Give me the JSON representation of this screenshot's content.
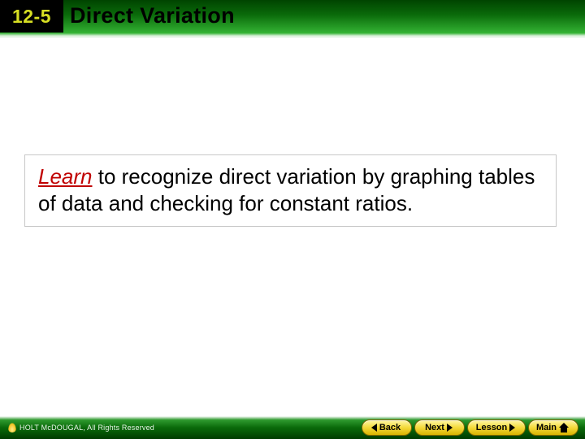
{
  "header": {
    "section_number": "12-5",
    "title": "Direct Variation"
  },
  "content": {
    "learn_label": "Learn",
    "objective_rest": " to recognize direct variation by graphing tables of data and checking for constant ratios."
  },
  "footer": {
    "copyright": "HOLT McDOUGAL, All Rights Reserved",
    "buttons": {
      "back": "Back",
      "next": "Next",
      "lesson": "Lesson",
      "main": "Main"
    }
  }
}
